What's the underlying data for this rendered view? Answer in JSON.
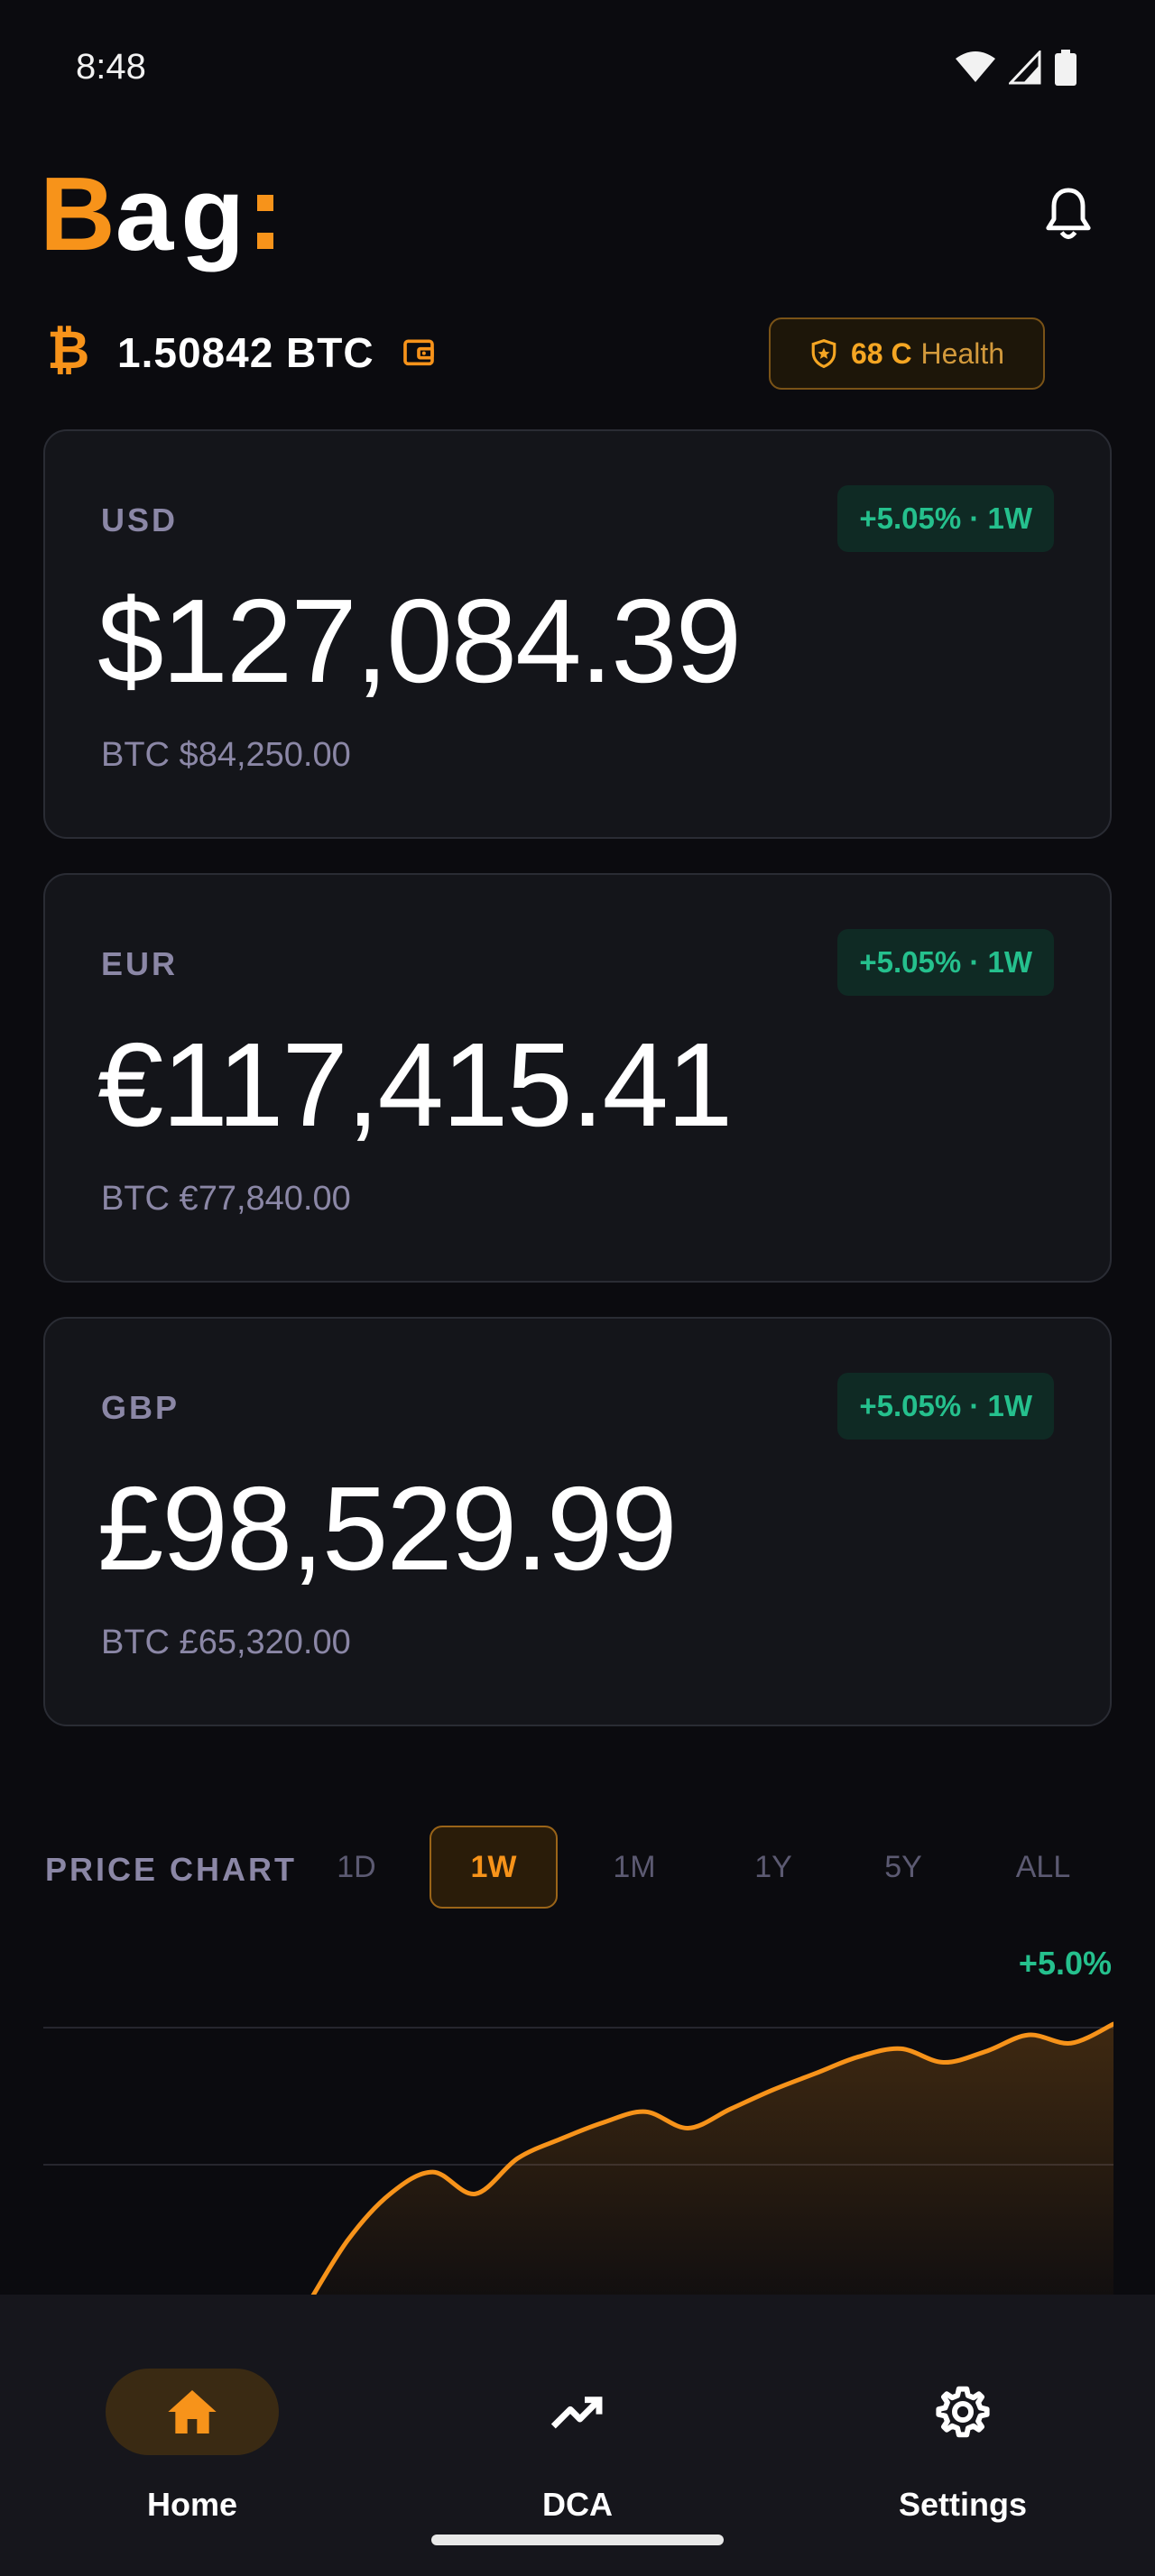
{
  "status_bar": {
    "time": "8:48"
  },
  "header": {
    "logo_first": "B",
    "logo_rest": "ag"
  },
  "balance": {
    "btc_amount": "1.50842 BTC",
    "health_score": "68 C",
    "health_label": "Health"
  },
  "cards": [
    {
      "code": "USD",
      "change": "+5.05% · 1W",
      "value": "$127,084.39",
      "btc_price": "BTC $84,250.00"
    },
    {
      "code": "EUR",
      "change": "+5.05% · 1W",
      "value": "€117,415.41",
      "btc_price": "BTC €77,840.00"
    },
    {
      "code": "GBP",
      "change": "+5.05% · 1W",
      "value": "£98,529.99",
      "btc_price": "BTC £65,320.00"
    }
  ],
  "price_chart": {
    "title": "PRICE CHART",
    "ranges": [
      "1D",
      "1W",
      "1M",
      "1Y",
      "5Y",
      "ALL"
    ],
    "selected_range": "1W",
    "change": "+5.0%"
  },
  "chart_data": {
    "type": "area",
    "title": "PRICE CHART",
    "x": [
      0,
      1,
      2,
      3,
      4,
      5,
      6,
      7,
      8,
      9,
      10,
      11,
      12,
      13,
      14,
      15,
      16,
      17,
      18,
      19
    ],
    "values": [
      0.0,
      0.25,
      0.42,
      0.5,
      0.42,
      0.55,
      0.62,
      0.68,
      0.72,
      0.66,
      0.73,
      0.8,
      0.86,
      0.92,
      0.95,
      0.9,
      0.94,
      1.0,
      0.97,
      1.04
    ],
    "series": [
      {
        "name": "",
        "values": [
          0.0,
          0.25,
          0.42,
          0.5,
          0.42,
          0.55,
          0.62,
          0.68,
          0.72,
          0.66,
          0.73,
          0.8,
          0.86,
          0.92,
          0.95,
          0.9,
          0.94,
          1.0,
          0.97,
          1.04
        ]
      }
    ],
    "xlabel": "",
    "ylabel": "",
    "grid": true,
    "color": "#f7931a"
  },
  "bottom_nav": {
    "items": [
      {
        "label": "Home",
        "icon": "home-icon",
        "active": true
      },
      {
        "label": "DCA",
        "icon": "trending-up-icon",
        "active": false
      },
      {
        "label": "Settings",
        "icon": "gear-icon",
        "active": false
      }
    ]
  },
  "colors": {
    "accent": "#f7931a",
    "positive": "#25c08d",
    "background": "#0b0b0f",
    "card": "#14151a"
  }
}
